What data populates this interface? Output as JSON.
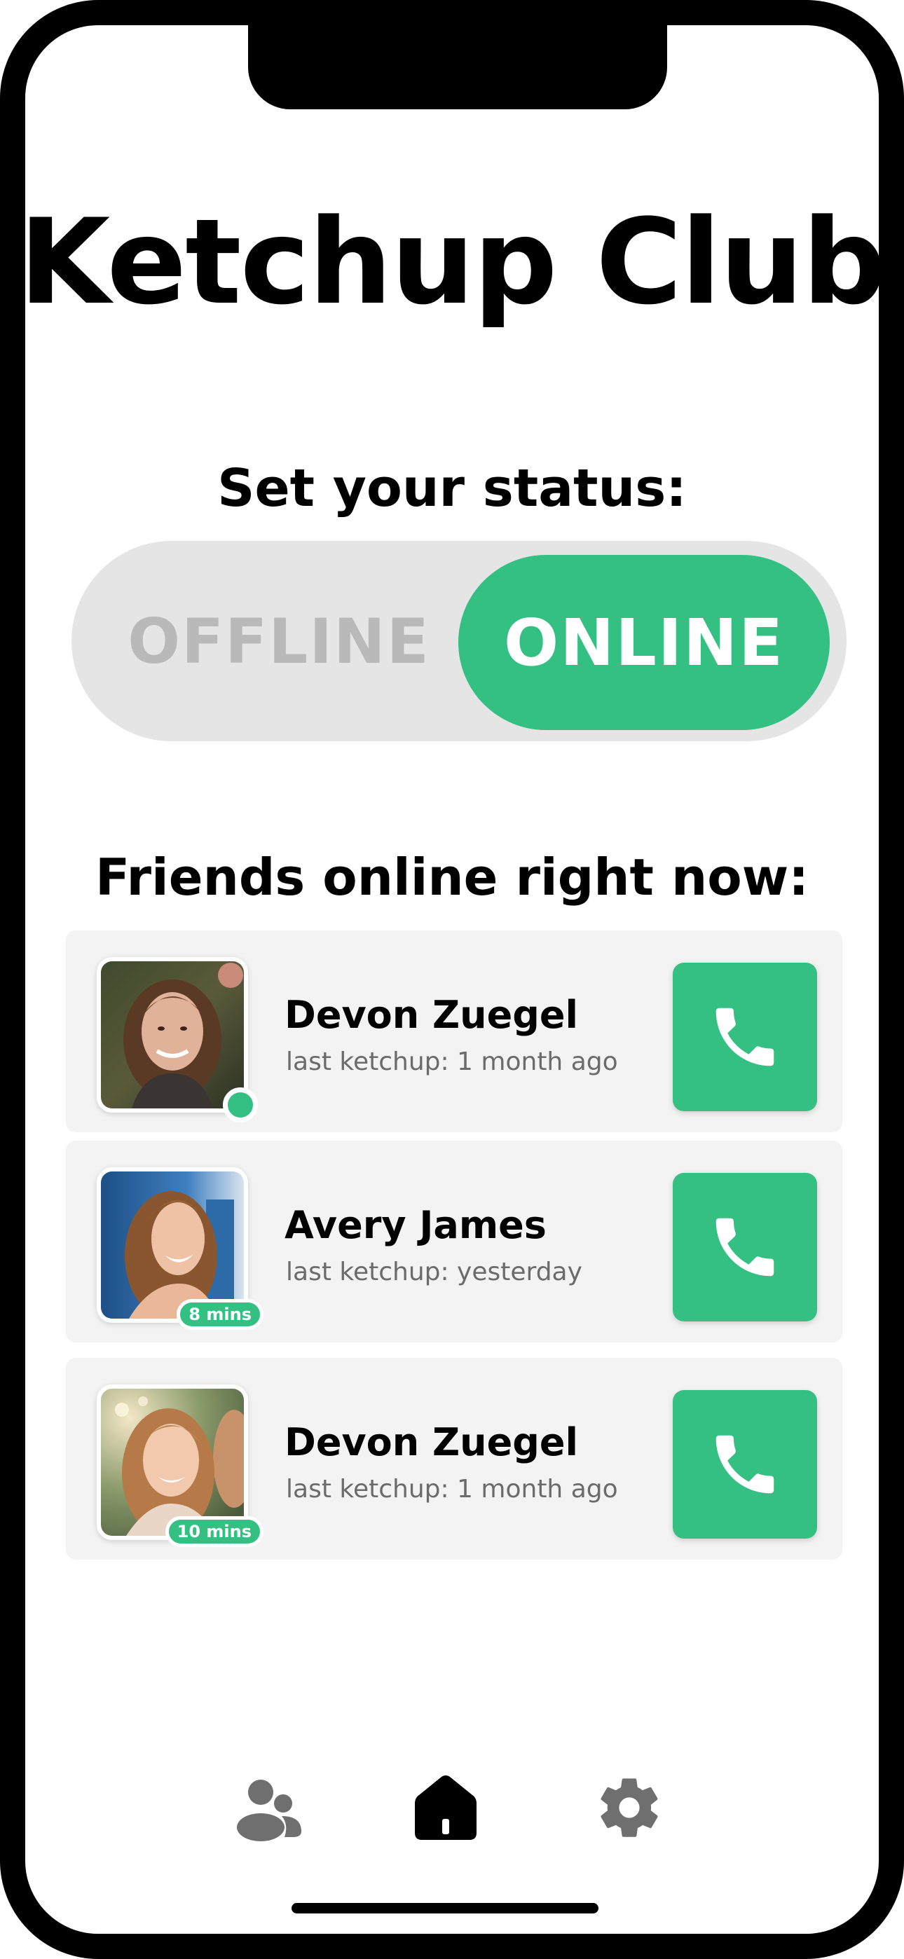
{
  "app": {
    "title": "Ketchup Club"
  },
  "status": {
    "heading": "Set your status:",
    "options": [
      "OFFLINE",
      "ONLINE"
    ],
    "selected": "ONLINE"
  },
  "friends": {
    "heading": "Friends online right now:",
    "items": [
      {
        "name": "Devon Zuegel",
        "last": "last ketchup: 1 month ago",
        "indicator": "online-dot",
        "badge": ""
      },
      {
        "name": "Avery James",
        "last": "last ketchup: yesterday",
        "indicator": "time-badge",
        "badge": "8 mins"
      },
      {
        "name": "Devon Zuegel",
        "last": "last ketchup: 1 month ago",
        "indicator": "time-badge",
        "badge": "10 mins"
      }
    ]
  },
  "tab_bar": {
    "items": [
      {
        "icon": "people-icon",
        "active": false
      },
      {
        "icon": "home-icon",
        "active": true
      },
      {
        "icon": "gear-icon",
        "active": false
      }
    ]
  },
  "colors": {
    "accent": "#34c082",
    "toggle_track": "#e5e5e5",
    "offline_text": "#b9b9b9",
    "card_bg": "#f3f3f3",
    "secondary_text": "#6b6b6b",
    "icon_gray": "#6f6f6f"
  }
}
